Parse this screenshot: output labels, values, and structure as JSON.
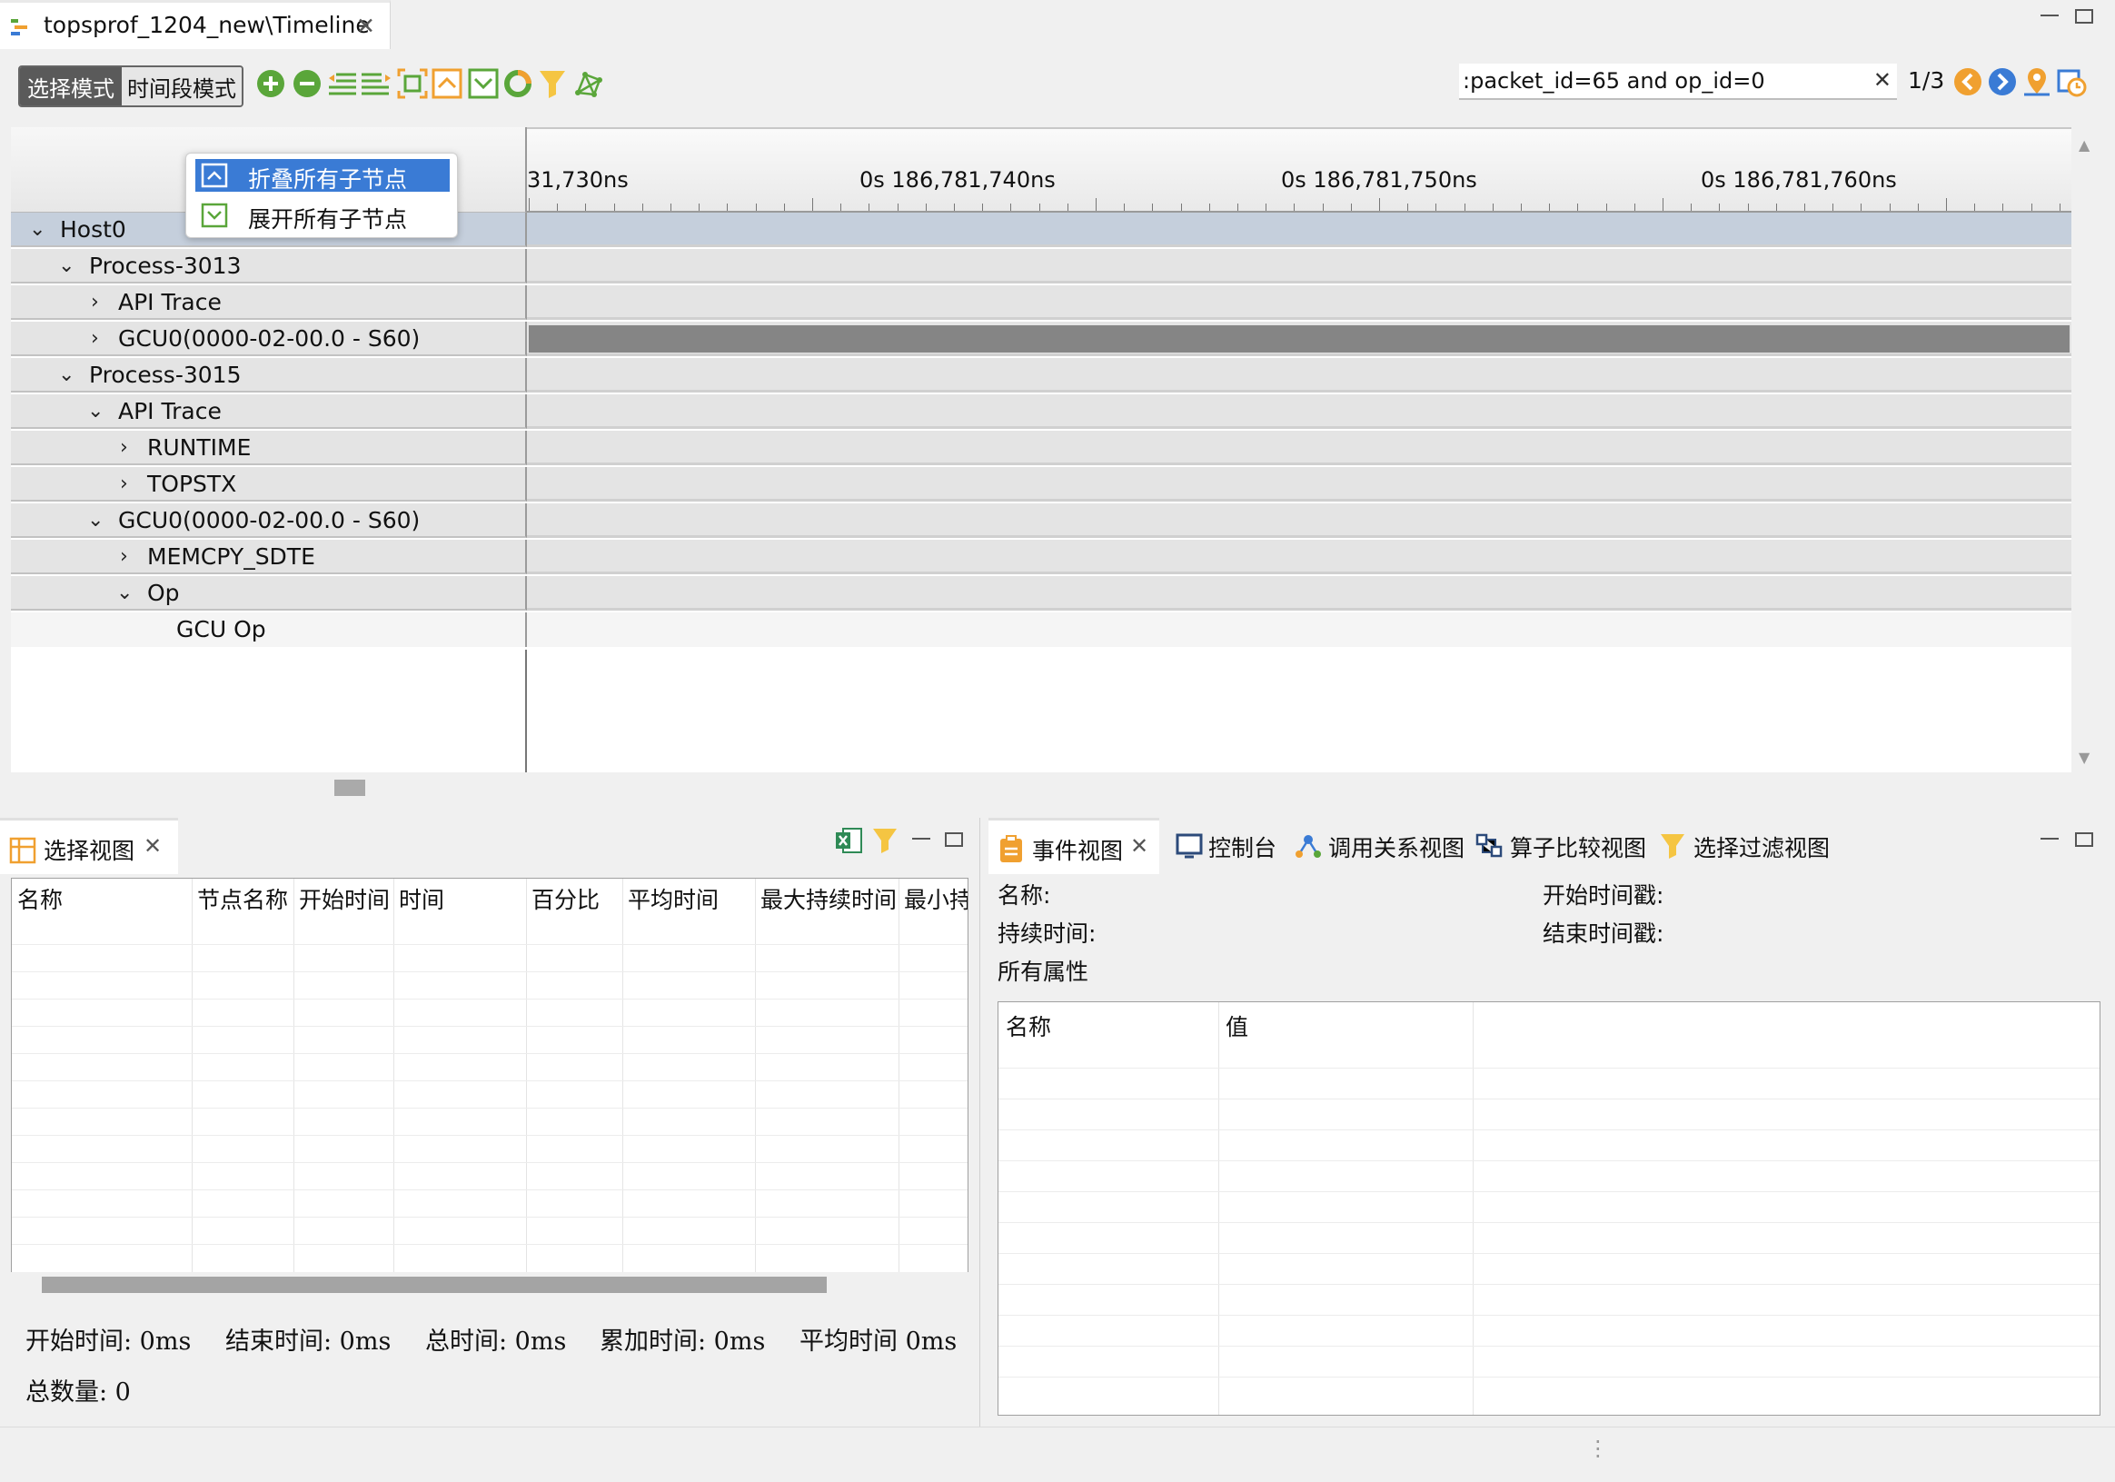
{
  "editor": {
    "tab_title": "topsprof_1204_new\\Timeline",
    "close_glyph": "✕"
  },
  "toolbar": {
    "mode_select": "选择模式",
    "mode_timerange": "时间段模式",
    "icons": [
      "zoom-in-icon",
      "zoom-out-icon",
      "collapse-list-icon",
      "expand-list-icon",
      "fit-icon",
      "collapse-all-icon",
      "expand-all-icon",
      "refresh-icon",
      "filter-icon",
      "graph-icon"
    ],
    "accent_green": "#5aa63a",
    "accent_orange": "#f0a030"
  },
  "search": {
    "value": ":packet_id=65 and op_id=0",
    "clear_glyph": "✕",
    "match_count": "1/3"
  },
  "ruler": {
    "ticks": [
      "31,730ns",
      "0s 186,781,740ns",
      "0s 186,781,750ns",
      "0s 186,781,760ns"
    ]
  },
  "popup_menu": {
    "items": [
      {
        "label": "折叠所有子节点",
        "highlighted": true
      },
      {
        "label": "展开所有子节点",
        "highlighted": false
      }
    ],
    "highlight_color": "#3a7bd5"
  },
  "tree": {
    "rows": [
      {
        "label": "Host0",
        "chevron": "⌄",
        "level": 0,
        "selected": true
      },
      {
        "label": "Process-3013",
        "chevron": "⌄",
        "level": 1
      },
      {
        "label": "API Trace",
        "chevron": "›",
        "level": 2
      },
      {
        "label": "GCU0(0000-02-00.0 - S60)",
        "chevron": "›",
        "level": 2,
        "has_bar": true
      },
      {
        "label": "Process-3015",
        "chevron": "⌄",
        "level": 1
      },
      {
        "label": "API Trace",
        "chevron": "⌄",
        "level": 2
      },
      {
        "label": "RUNTIME",
        "chevron": "›",
        "level": 3
      },
      {
        "label": "TOPSTX",
        "chevron": "›",
        "level": 3
      },
      {
        "label": "GCU0(0000-02-00.0 - S60)",
        "chevron": "⌄",
        "level": 2
      },
      {
        "label": "MEMCPY_SDTE",
        "chevron": "›",
        "level": 3
      },
      {
        "label": "Op",
        "chevron": "⌄",
        "level": 3
      },
      {
        "label": "GCU Op",
        "chevron": "",
        "level": 4
      }
    ]
  },
  "selection_view": {
    "tab_label": "选择视图",
    "columns": [
      "名称",
      "节点名称",
      "开始时间",
      "时间",
      "百分比",
      "平均时间",
      "最大持续时间",
      "最小持"
    ],
    "stats": {
      "start": "开始时间: 0ms",
      "end": "结束时间: 0ms",
      "total": "总时间: 0ms",
      "cumulative": "累加时间: 0ms",
      "average": "平均时间 0ms",
      "count": "总数量: 0"
    }
  },
  "event_view": {
    "tabs": [
      "事件视图",
      "控制台",
      "调用关系视图",
      "算子比较视图",
      "选择过滤视图"
    ],
    "fields": {
      "name": "名称:",
      "start_ts": "开始时间戳:",
      "duration": "持续时间:",
      "end_ts": "结束时间戳:",
      "all_attrs": "所有属性"
    },
    "columns": [
      "名称",
      "值"
    ]
  }
}
